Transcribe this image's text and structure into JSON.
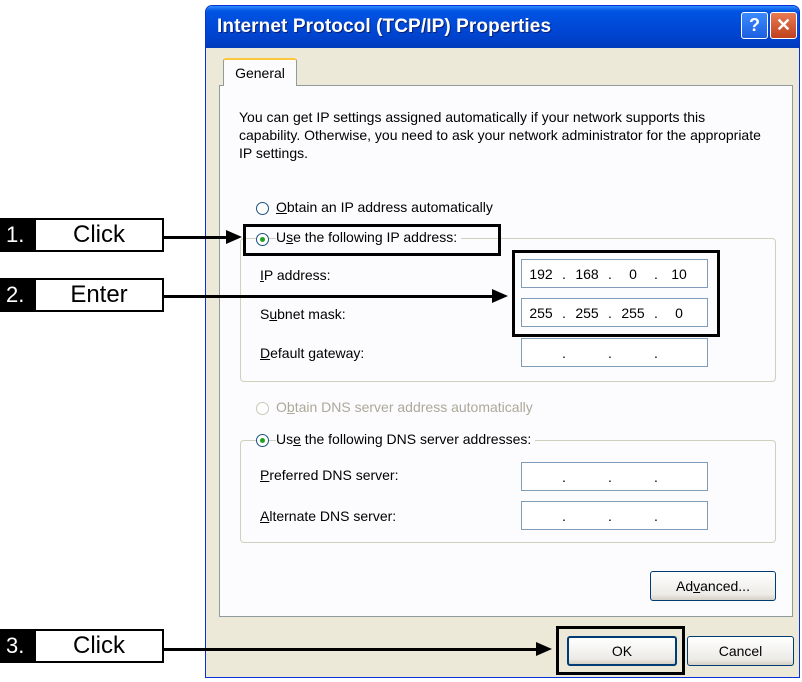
{
  "window": {
    "title": "Internet Protocol (TCP/IP) Properties",
    "help_label": "?",
    "close_label": "✕"
  },
  "tab": {
    "label": "General"
  },
  "description": "You can get IP settings assigned automatically if your network supports this capability. Otherwise, you need to ask your network administrator for the appropriate IP settings.",
  "ip_section": {
    "auto_radio": {
      "mnemonic": "O",
      "rest": "btain an IP address automatically",
      "checked": false
    },
    "manual_radio": {
      "pre": "U",
      "mnemonic": "s",
      "rest": "e the following IP address:",
      "checked": true
    },
    "fields": {
      "ip_address": {
        "mnemonic": "I",
        "rest": "P address:",
        "value": [
          "192",
          "168",
          "0",
          "10"
        ]
      },
      "subnet_mask": {
        "pre": "S",
        "mnemonic": "u",
        "rest": "bnet mask:",
        "value": [
          "255",
          "255",
          "255",
          "0"
        ]
      },
      "default_gateway": {
        "mnemonic": "D",
        "rest": "efault gateway:",
        "value": [
          "",
          "",
          "",
          ""
        ]
      }
    }
  },
  "dns_section": {
    "auto_radio": {
      "pre": "O",
      "mnemonic": "b",
      "rest": "tain DNS server address automatically",
      "disabled": true
    },
    "manual_radio": {
      "pre": "Us",
      "mnemonic": "e",
      "rest": " the following DNS server addresses:",
      "checked": true
    },
    "fields": {
      "preferred": {
        "mnemonic": "P",
        "rest": "referred DNS server:"
      },
      "alternate": {
        "mnemonic": "A",
        "rest": "lternate DNS server:"
      }
    }
  },
  "buttons": {
    "advanced": {
      "pre": "Ad",
      "mnemonic": "v",
      "rest": "anced..."
    },
    "ok": "OK",
    "cancel": "Cancel"
  },
  "callouts": [
    {
      "number": "1.",
      "label": "Click"
    },
    {
      "number": "2.",
      "label": "Enter"
    },
    {
      "number": "3.",
      "label": "Click"
    }
  ],
  "colors": {
    "title_bar": "#0054E3",
    "dialog_bg": "#ECE9D8",
    "panel_bg": "#FCFCFE",
    "radio_dot": "#21A121",
    "close_button": "#C0401D"
  }
}
